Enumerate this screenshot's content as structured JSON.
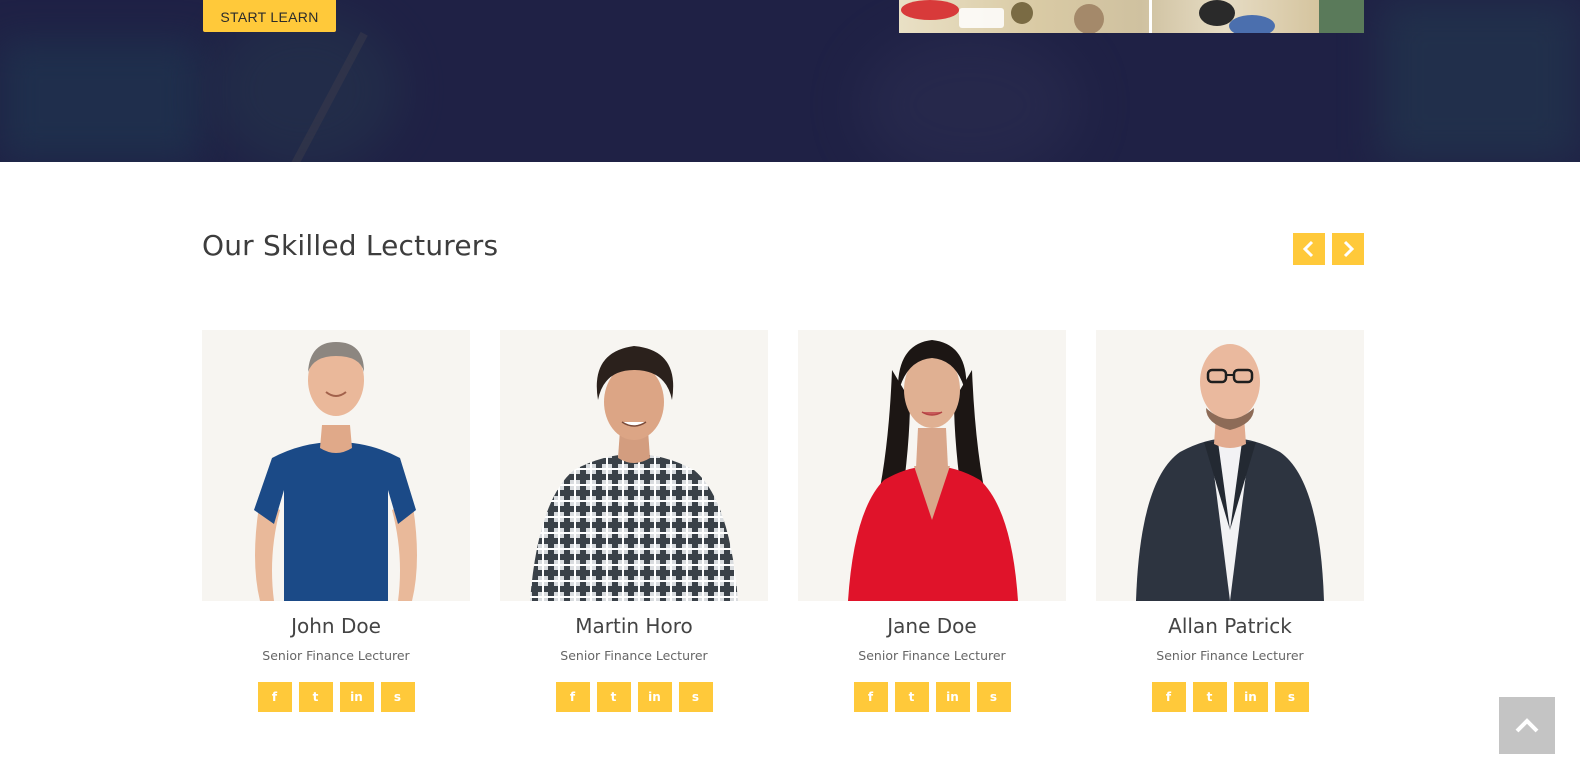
{
  "hero": {
    "button_label": "START LEARN"
  },
  "lecturers": {
    "title": "Our Skilled Lecturers",
    "nav": {
      "prev_icon": "chevron-left-icon",
      "next_icon": "chevron-right-icon"
    },
    "items": [
      {
        "name": "John Doe",
        "role": "Senior Finance Lecturer"
      },
      {
        "name": "Martin Horo",
        "role": "Senior Finance Lecturer"
      },
      {
        "name": "Jane Doe",
        "role": "Senior Finance Lecturer"
      },
      {
        "name": "Allan Patrick",
        "role": "Senior Finance Lecturer"
      }
    ],
    "social_icons": [
      {
        "icon": "facebook-icon",
        "glyph": "f"
      },
      {
        "icon": "twitter-icon",
        "glyph": "t"
      },
      {
        "icon": "linkedin-icon",
        "glyph": "in"
      },
      {
        "icon": "skype-icon",
        "glyph": "s"
      }
    ]
  },
  "back_to_top": {
    "icon": "chevron-up-icon"
  },
  "colors": {
    "accent": "#ffc93a",
    "hero_bg": "#1f2145",
    "heading": "#3d3d3d",
    "subtext": "#666666"
  }
}
